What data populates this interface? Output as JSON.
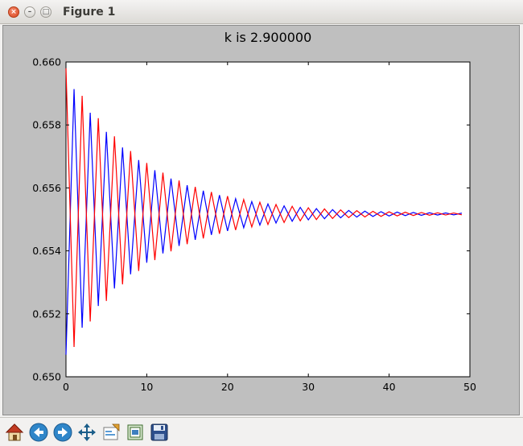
{
  "window": {
    "title": "Figure 1",
    "close_glyph": "×",
    "minimize_glyph": "–",
    "maximize_glyph": "□"
  },
  "toolbar": {
    "tools": [
      {
        "name": "home-icon"
      },
      {
        "name": "back-arrow-icon"
      },
      {
        "name": "forward-arrow-icon"
      },
      {
        "name": "pan-icon"
      },
      {
        "name": "zoom-rect-icon"
      },
      {
        "name": "subplots-config-icon"
      },
      {
        "name": "save-icon"
      }
    ]
  },
  "chart_data": {
    "type": "line",
    "title": "k is 2.900000",
    "xlim": [
      0,
      50
    ],
    "ylim": [
      0.65,
      0.66
    ],
    "xticks": [
      "0",
      "10",
      "20",
      "30",
      "40",
      "50"
    ],
    "yticks": [
      "0.650",
      "0.652",
      "0.654",
      "0.656",
      "0.658",
      "0.660"
    ],
    "grid": false,
    "series": [
      {
        "color": "#0000ff",
        "model": {
          "k": 2.9,
          "x0": 0.6507,
          "n": 50
        }
      },
      {
        "color": "#ff0000",
        "model": {
          "k": 2.9,
          "x0": 0.6598,
          "n": 50
        }
      }
    ]
  }
}
